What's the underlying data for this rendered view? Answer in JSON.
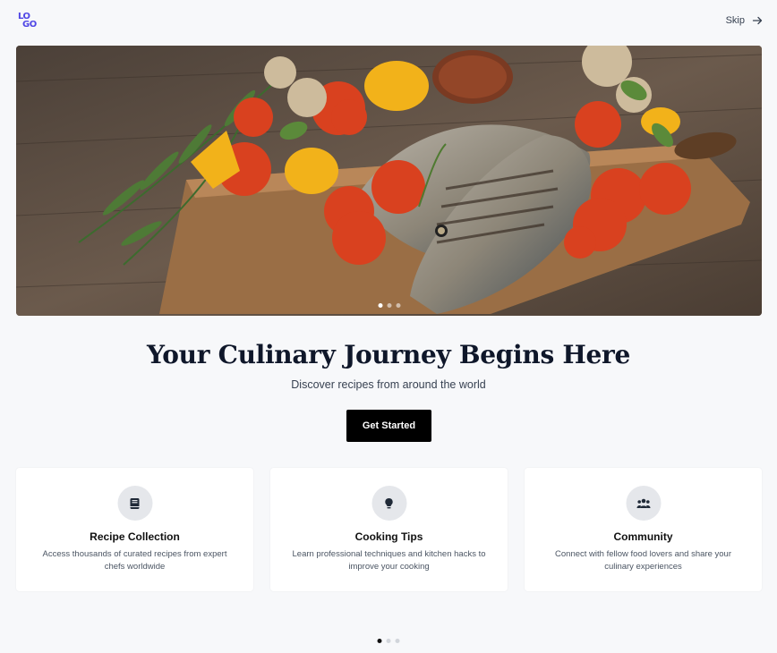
{
  "header": {
    "logo_line1": "LO",
    "logo_line2": "GO",
    "skip_label": "Skip",
    "skip_icon": "arrow-right-icon"
  },
  "hero": {
    "image": "grilled-fish-with-vegetables-photo",
    "slides": 3,
    "active_slide": 1
  },
  "main": {
    "headline": "Your Culinary Journey Begins Here",
    "subheadline": "Discover recipes from around the world",
    "cta_label": "Get Started"
  },
  "features": [
    {
      "icon": "book-icon",
      "title": "Recipe Collection",
      "description": "Access thousands of curated recipes from expert chefs worldwide"
    },
    {
      "icon": "lightbulb-icon",
      "title": "Cooking Tips",
      "description": "Learn professional techniques and kitchen hacks to improve your cooking"
    },
    {
      "icon": "users-icon",
      "title": "Community",
      "description": "Connect with fellow food lovers and share your culinary experiences"
    }
  ],
  "pagination": {
    "pages": 3,
    "active_page": 1
  },
  "colors": {
    "accent": "#4f46e5",
    "background": "#f7f8fa",
    "cta_background": "#000000"
  }
}
